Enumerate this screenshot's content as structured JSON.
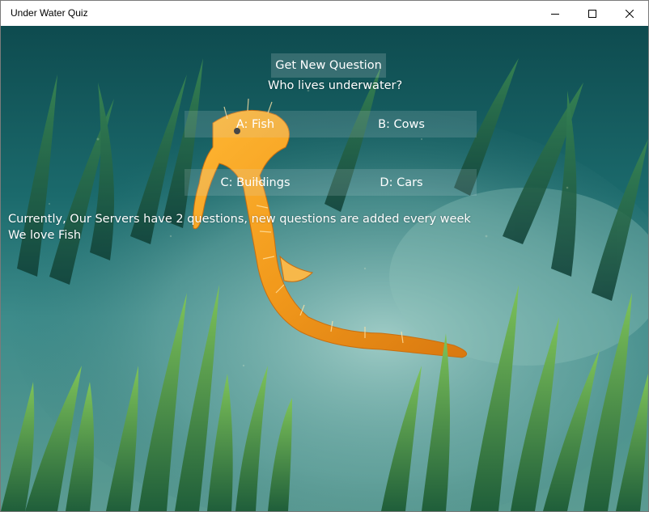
{
  "window": {
    "title": "Under Water Quiz",
    "controls": {
      "minimize": "minimize",
      "maximize": "maximize",
      "close": "close"
    }
  },
  "quiz": {
    "get_question_label": "Get New Question",
    "question": "Who lives underwater?",
    "answers": [
      {
        "label": "A: Fish"
      },
      {
        "label": "B: Cows"
      },
      {
        "label": "C: Buildings"
      },
      {
        "label": "D: Cars"
      }
    ],
    "status_line": "Currently, Our Servers have 2 questions, new questions are added every week",
    "tagline": "We love Fish"
  },
  "background": {
    "description_icon": "seahorse-seagrass-photo",
    "water_color": "#1d6f73",
    "sand_color": "#8ec0bd",
    "seahorse_color": "#f0a020",
    "grass_color": "#3f8a3a"
  }
}
